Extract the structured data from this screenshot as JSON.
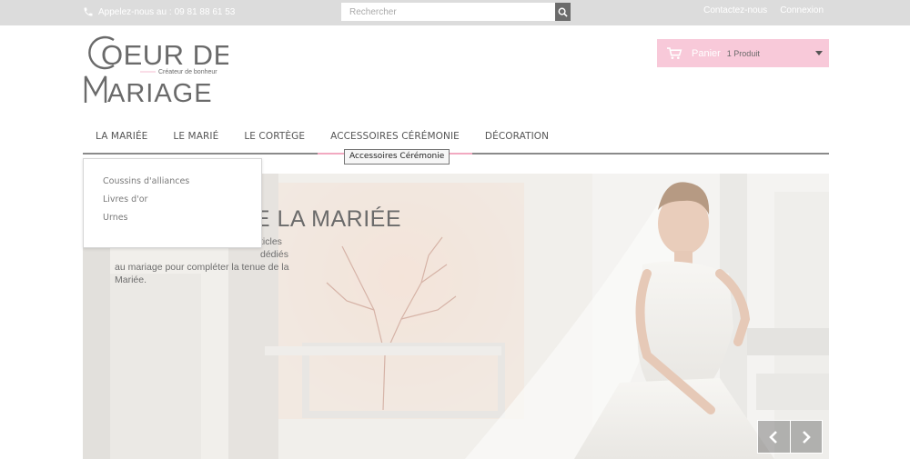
{
  "topbar": {
    "phone_label": "Appelez-nous au :",
    "phone_number": "09 81 88 61 53",
    "search_placeholder": "Rechercher",
    "contact_link": "Contactez-nous",
    "login_link": "Connexion"
  },
  "logo": {
    "line1": "OEUR DE",
    "tagline": "Créateur de bonheur",
    "line2": "ARIAGE"
  },
  "cart": {
    "label": "Panier",
    "count": "1 Produit"
  },
  "nav": {
    "items": [
      {
        "label": "LA MARIÉE"
      },
      {
        "label": "LE MARIÉ"
      },
      {
        "label": "LE CORTÈGE"
      },
      {
        "label": "ACCESSOIRES CÉRÉMONIE"
      },
      {
        "label": "DÉCORATION"
      }
    ],
    "tooltip": "Accessoires Cérémonie"
  },
  "dropdown": {
    "items": [
      {
        "label": "Coussins d'alliances"
      },
      {
        "label": "Livres d'or"
      },
      {
        "label": "Urnes"
      }
    ]
  },
  "hero": {
    "title": "E LA MARIÉE",
    "text_line1": "ticles dédiés",
    "text_line2": "au mariage pour compléter la tenue de la",
    "text_line3": "Mariée."
  },
  "colors": {
    "topbar_bg": "#dcdcdc",
    "cart_bg": "#f8c9d9",
    "nav_active": "#f2a9c1",
    "text": "#555555"
  },
  "icons": {
    "phone": "phone-icon",
    "search": "search-icon",
    "cart": "shopping-cart-icon",
    "dropdown_caret": "caret-down-icon",
    "prev": "chevron-left-icon",
    "next": "chevron-right-icon"
  }
}
